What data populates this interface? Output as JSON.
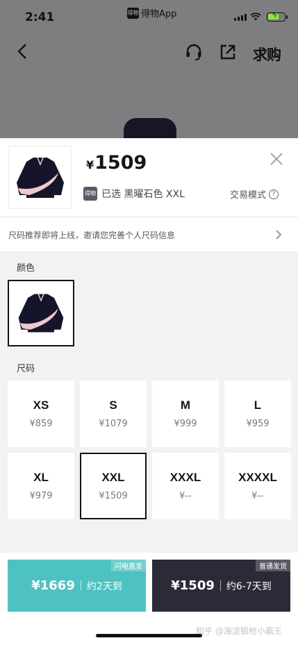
{
  "status_bar": {
    "time": "2:41",
    "app_name": "得物App",
    "app_logo_text": "得物"
  },
  "nav": {
    "back_icon": "chevron-left-icon",
    "headset_icon": "headset-icon",
    "share_icon": "share-icon",
    "qiugou_label": "求购"
  },
  "product": {
    "currency": "¥",
    "price": "1509",
    "selected_badge": "得物",
    "selected_text": "已选 黑曜石色 XXL",
    "trade_mode_label": "交易模式",
    "trade_mode_icon": "?"
  },
  "notice": {
    "text": "尺码推荐即将上线，邀请您完善个人尺码信息"
  },
  "color_section": {
    "label": "颜色"
  },
  "size_section": {
    "label": "尺码",
    "sizes": [
      {
        "name": "XS",
        "price": "¥859"
      },
      {
        "name": "S",
        "price": "¥1079"
      },
      {
        "name": "M",
        "price": "¥999"
      },
      {
        "name": "L",
        "price": "¥959"
      },
      {
        "name": "XL",
        "price": "¥979"
      },
      {
        "name": "XXL",
        "price": "¥1509",
        "selected": true
      },
      {
        "name": "XXXL",
        "price": "¥--"
      },
      {
        "name": "XXXXL",
        "price": "¥--"
      }
    ]
  },
  "buy_options": {
    "fast": {
      "tag": "闪电直发",
      "price": "¥1669",
      "eta": "约2天到",
      "color": "#4ec2c2"
    },
    "normal": {
      "tag": "普通发货",
      "price": "¥1509",
      "eta": "约6-7天到",
      "color": "#2b2b38"
    }
  },
  "watermark": "知乎 @海淀银枪小霸王"
}
